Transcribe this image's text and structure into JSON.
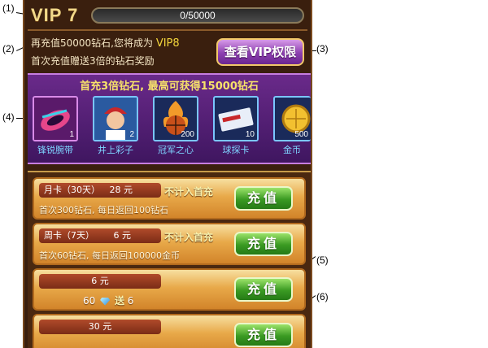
{
  "callouts": [
    "(1)",
    "(2)",
    "(3)",
    "(4)",
    "(5)",
    "(6)"
  ],
  "header": {
    "vip_level": "VIP 7",
    "progress_text": "0/50000",
    "progress_fraction": 0.0
  },
  "info": {
    "line1_prefix": "再充值50000钻石,您将成为",
    "line1_vip": "VIP8",
    "line2": "首次充值赠送3倍的钻石奖励"
  },
  "view_vip_button": "查看VIP权限",
  "reward_strip": {
    "title": "首充3倍钻石, 最高可获得15000钻石",
    "items": [
      {
        "name": "锋锐腕带",
        "count": "1",
        "icon": "wristband-icon"
      },
      {
        "name": "井上彩子",
        "count": "2",
        "icon": "character-portrait-icon"
      },
      {
        "name": "冠军之心",
        "count": "200",
        "icon": "flaming-basketball-icon"
      },
      {
        "name": "球探卡",
        "count": "10",
        "icon": "scout-card-icon"
      },
      {
        "name": "金币",
        "count": "500",
        "icon": "gold-coin-icon"
      }
    ]
  },
  "packs": [
    {
      "label": "月卡（30天）",
      "price": "28",
      "unit": "元",
      "tag": "不计入首充",
      "desc": "首次300钻石, 每日返回100钻石",
      "button": "充值"
    },
    {
      "label": "周卡（7天）",
      "price": "6",
      "unit": "元",
      "tag": "不计入首充",
      "desc": "首次60钻石, 每日返回100000金币",
      "button": "充值"
    },
    {
      "price_text": "6 元",
      "bonus_base": "60",
      "bonus_word": "送",
      "bonus_extra": "6",
      "button": "充值"
    },
    {
      "price_text": "30 元",
      "button": "充值"
    }
  ],
  "colors": {
    "panel_bg": "#3a1f0e",
    "vip_gold": "#f2d98a",
    "recharge_green": "#3a9a22",
    "purple_strip": "#6a2a8a"
  }
}
